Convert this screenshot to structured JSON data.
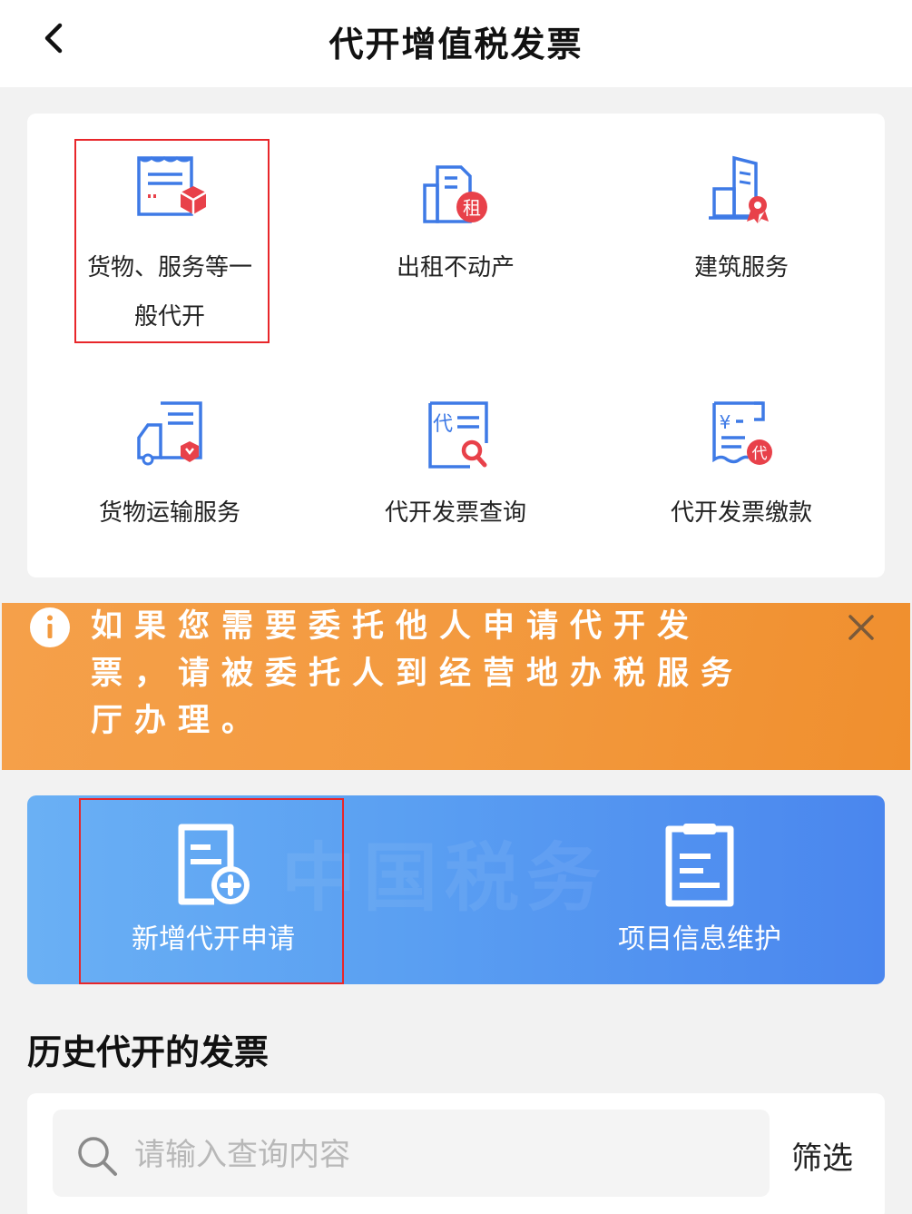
{
  "header": {
    "title": "代开增值税发票"
  },
  "services": [
    {
      "label": "货物、服务等一般代开",
      "icon": "goods-service-invoice-icon"
    },
    {
      "label": "出租不动产",
      "icon": "rent-property-icon"
    },
    {
      "label": "建筑服务",
      "icon": "construction-service-icon"
    },
    {
      "label": "货物运输服务",
      "icon": "cargo-transport-icon"
    },
    {
      "label": "代开发票查询",
      "icon": "invoice-query-icon"
    },
    {
      "label": "代开发票缴款",
      "icon": "invoice-payment-icon"
    }
  ],
  "notice": {
    "text": "如果您需要委托他人申请代开发票，请被委托人到经营地办税服务厅办理。"
  },
  "actions": {
    "new_label": "新增代开申请",
    "project_label": "项目信息维护",
    "watermark": "中国税务"
  },
  "history": {
    "title": "历史代开的发票",
    "search_placeholder": "请输入查询内容",
    "filter_label": "筛选"
  },
  "colors": {
    "accent_blue": "#3e7ae6",
    "accent_red": "#e8414a",
    "notice_orange": "#f39a3f",
    "highlight_red": "#e8262a"
  }
}
